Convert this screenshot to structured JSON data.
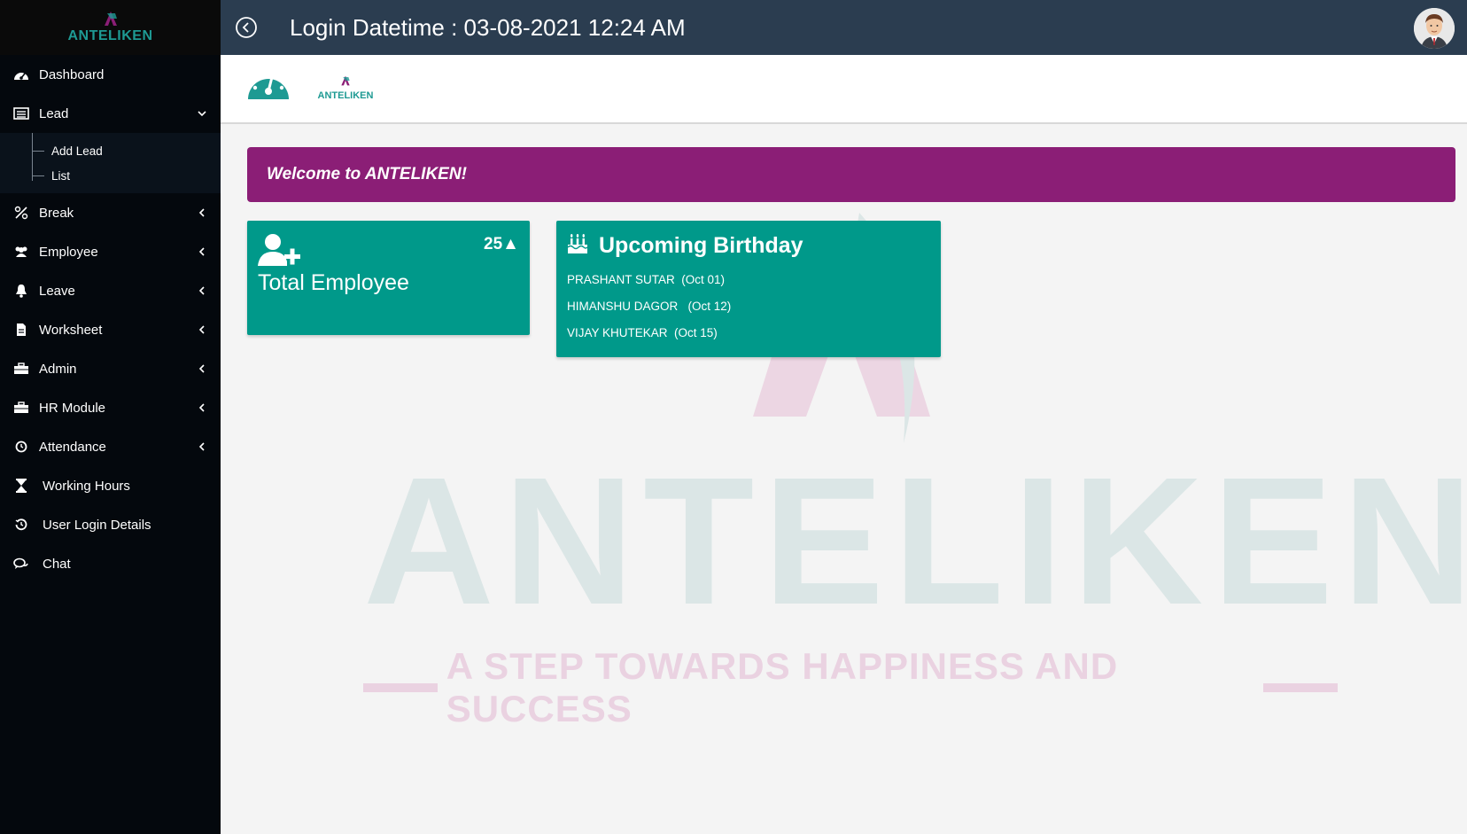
{
  "brand": {
    "name": "ANTELIKEN"
  },
  "sidebar": {
    "items": [
      {
        "label": "Dashboard",
        "icon": "dashboard-icon"
      },
      {
        "label": "Lead",
        "icon": "list-icon",
        "expanded": true,
        "children": [
          {
            "label": "Add Lead"
          },
          {
            "label": "List"
          }
        ]
      },
      {
        "label": "Break",
        "icon": "break-icon"
      },
      {
        "label": "Employee",
        "icon": "users-icon"
      },
      {
        "label": "Leave",
        "icon": "bell-icon"
      },
      {
        "label": "Worksheet",
        "icon": "file-icon"
      },
      {
        "label": "Admin",
        "icon": "briefcase-icon"
      },
      {
        "label": "HR Module",
        "icon": "briefcase-icon"
      },
      {
        "label": "Attendance",
        "icon": "clock-icon"
      },
      {
        "label": "Working Hours",
        "icon": "hourglass-icon"
      },
      {
        "label": "User Login Details",
        "icon": "history-icon"
      },
      {
        "label": "Chat",
        "icon": "chat-icon"
      }
    ]
  },
  "topbar": {
    "login_datetime": "Login Datetime : 03-08-2021 12:24 AM"
  },
  "subheader": {
    "mini_logo_text": "ANTELIKEN"
  },
  "watermark": {
    "title": "ANTELIKEN",
    "tagline": "A STEP TOWARDS HAPPINESS AND SUCCESS"
  },
  "welcome": {
    "text": "Welcome to ANTELIKEN!"
  },
  "cards": {
    "total_employee": {
      "title": "Total Employee",
      "count": "25▲"
    },
    "upcoming_birthday": {
      "title": "Upcoming Birthday",
      "entries": [
        {
          "text": "PRASHANT SUTAR  (Oct 01)"
        },
        {
          "text": "HIMANSHU DAGOR   (Oct 12)"
        },
        {
          "text": "VIJAY KHUTEKAR  (Oct 15)"
        }
      ]
    }
  },
  "colors": {
    "sidebar_bg": "#04080d",
    "topbar_bg": "#2b3d50",
    "accent_teal": "#00998a",
    "welcome_bg": "#8b1e76"
  }
}
